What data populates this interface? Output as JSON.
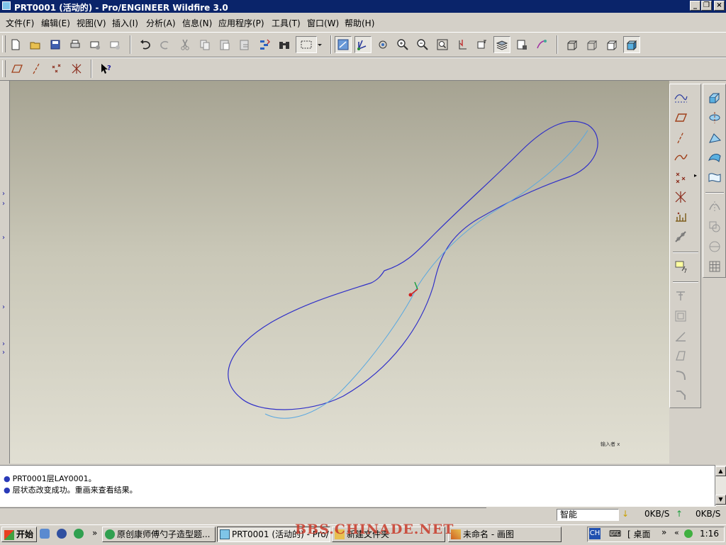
{
  "window": {
    "title": "PRT0001 (活动的) - Pro/ENGINEER Wildfire 3.0"
  },
  "menu": [
    "文件(F)",
    "编辑(E)",
    "视图(V)",
    "插入(I)",
    "分析(A)",
    "信息(N)",
    "应用程序(P)",
    "工具(T)",
    "窗口(W)",
    "帮助(H)"
  ],
  "toolbar_icons": [
    "new-icon",
    "open-icon",
    "save-icon",
    "print-icon",
    "send-mail-icon",
    "send-mail-attach-icon",
    "undo-icon",
    "redo-icon",
    "cut-icon",
    "copy-icon",
    "paste-icon",
    "paste-special-icon",
    "regenerate-icon",
    "find-icon",
    "select-box-icon",
    "repaint-icon",
    "spin-center-icon",
    "orient-mode-icon",
    "zoom-in-icon",
    "zoom-out-icon",
    "refit-icon",
    "reorient-icon",
    "saved-views-icon",
    "layers-icon",
    "view-manager-icon",
    "appearance-icon",
    "wireframe-icon",
    "hidden-line-icon",
    "no-hidden-icon",
    "shading-icon"
  ],
  "datum_display_icons": [
    "datum-plane-display-icon",
    "datum-axis-display-icon",
    "datum-point-display-icon",
    "coordinate-system-display-icon"
  ],
  "viewport": {
    "watermark": "输入者 x",
    "curves_color": "#3030c8",
    "sketch_color": "#5aa8e0"
  },
  "right_toolbar": [
    "sketched-curve-icon",
    "datum-plane-icon",
    "datum-axis-icon",
    "datum-curve-icon",
    "datum-point-icon",
    "datum-csys-icon",
    "analysis-icon",
    "datum-ref-icon",
    "note-icon",
    "hole-icon",
    "shell-icon",
    "rib-icon",
    "draft-icon",
    "round-icon",
    "chamfer-icon"
  ],
  "right_toolbar2": [
    "extrude-icon",
    "revolve-icon",
    "variable-section-sweep-icon",
    "boundary-blend-icon",
    "style-icon",
    "mirror-icon",
    "merge-icon",
    "trim-icon",
    "pattern-icon"
  ],
  "messages": [
    "PRT0001层LAY0001。",
    "层状态改变成功。重画来查看结果。"
  ],
  "status": {
    "smart_filter": "智能",
    "down_speed": "0KB/S",
    "up_speed": "0KB/S"
  },
  "taskbar": {
    "start": "开始",
    "tasks": [
      "原创康师傅勺子造型题...",
      "PRT0001 (活动的) - Pro/...",
      "新建文件夹",
      "未命名 - 画图"
    ],
    "desktop": "桌面",
    "clock": "1:16",
    "ime": "CH",
    "watermark": "BBS.CHINADE.NET"
  }
}
